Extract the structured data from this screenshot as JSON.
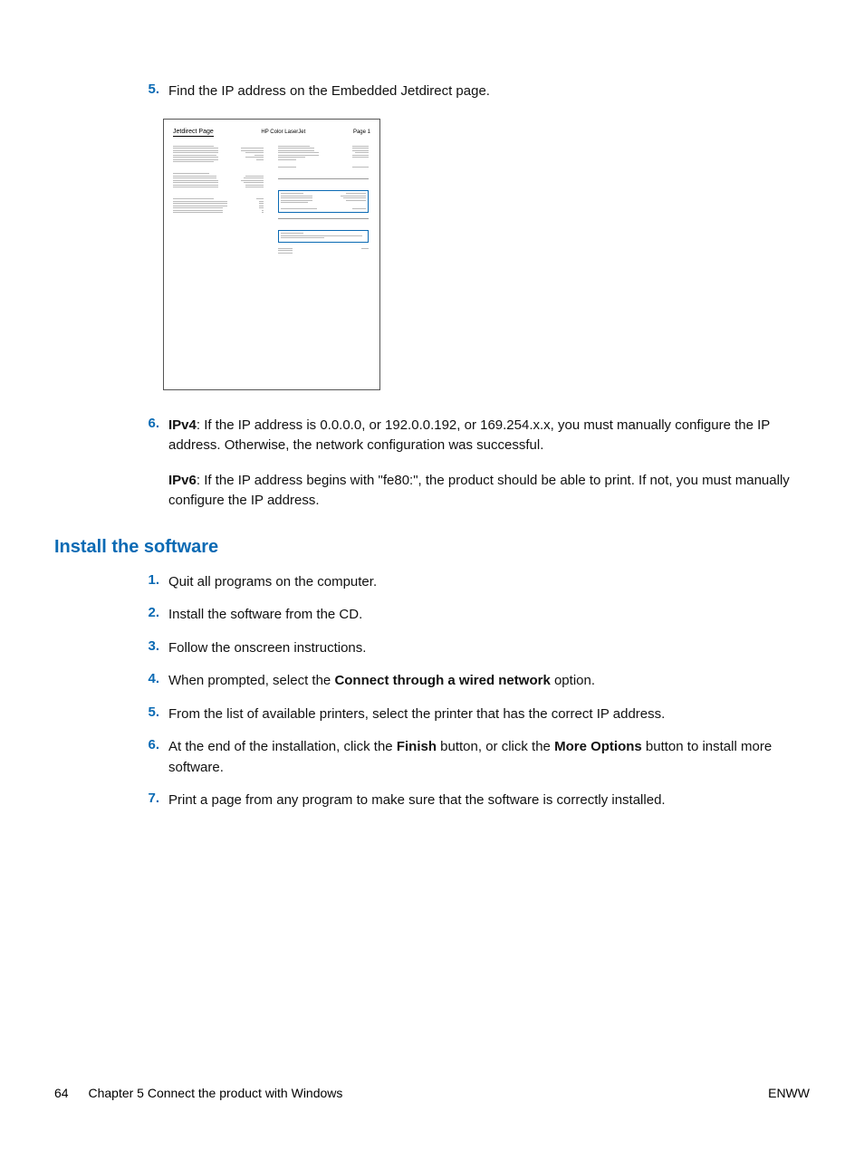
{
  "steps_top": [
    {
      "num": "5.",
      "text": "Find the IP address on the Embedded Jetdirect page."
    },
    {
      "num": "6.",
      "ipv4_label": "IPv4",
      "ipv4_text": ": If the IP address is 0.0.0.0, or 192.0.0.192, or 169.254.x.x, you must manually configure the IP address. Otherwise, the network configuration was successful.",
      "ipv6_label": "IPv6",
      "ipv6_text": ": If the IP address begins with \"fe80:\", the product should be able to print. If not, you must manually configure the IP address."
    }
  ],
  "diagram": {
    "title": "Jetdirect Page",
    "center": "HP Color LaserJet",
    "page_label": "Page 1"
  },
  "section_heading": "Install the software",
  "install_steps": [
    {
      "num": "1.",
      "text": "Quit all programs on the computer."
    },
    {
      "num": "2.",
      "text": "Install the software from the CD."
    },
    {
      "num": "3.",
      "text": "Follow the onscreen instructions."
    },
    {
      "num": "4.",
      "pre": "When prompted, select the ",
      "bold": "Connect through a wired network",
      "post": " option."
    },
    {
      "num": "5.",
      "text": "From the list of available printers, select the printer that has the correct IP address."
    },
    {
      "num": "6.",
      "pre": "At the end of the installation, click the ",
      "bold1": "Finish",
      "mid": " button, or click the ",
      "bold2": "More Options",
      "post": " button to install more software."
    },
    {
      "num": "7.",
      "text": "Print a page from any program to make sure that the software is correctly installed."
    }
  ],
  "footer": {
    "page_number": "64",
    "chapter": "Chapter 5   Connect the product with Windows",
    "right": "ENWW"
  }
}
